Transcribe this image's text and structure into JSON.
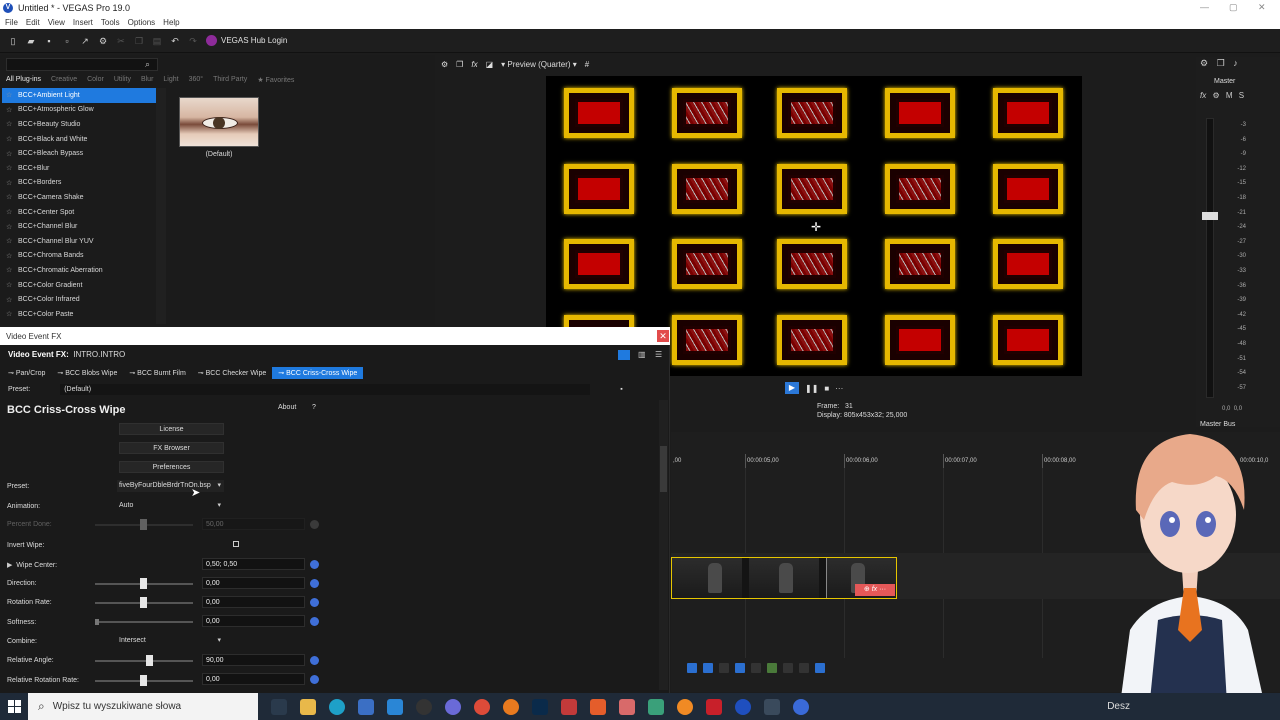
{
  "window": {
    "title": "Untitled * - VEGAS Pro 19.0",
    "logo_letter": "V"
  },
  "menu": [
    "File",
    "Edit",
    "View",
    "Insert",
    "Tools",
    "Options",
    "Help"
  ],
  "toolbar": {
    "hub_label": "VEGAS Hub Login"
  },
  "plugins": {
    "tabs": [
      "All Plug-ins",
      "Creative",
      "Color",
      "Utility",
      "Blur",
      "Light",
      "360°",
      "Third Party",
      "Favorites"
    ],
    "items": [
      "BCC+Ambient Light",
      "BCC+Atmospheric Glow",
      "BCC+Beauty Studio",
      "BCC+Black and White",
      "BCC+Bleach Bypass",
      "BCC+Blur",
      "BCC+Borders",
      "BCC+Camera Shake",
      "BCC+Center Spot",
      "BCC+Channel Blur",
      "BCC+Channel Blur YUV",
      "BCC+Chroma Bands",
      "BCC+Chromatic Aberration",
      "BCC+Color Gradient",
      "BCC+Color Infrared",
      "BCC+Color Paste"
    ],
    "selected_index": 0,
    "preset_thumb_label": "(Default)"
  },
  "preview": {
    "quality": "Preview (Quarter)",
    "frame_label": "Frame:",
    "frame": "31",
    "display_label": "Display:",
    "display": "805x453x32; 25,000"
  },
  "mixer": {
    "title": "Master",
    "bus": "Master Bus",
    "fx": "fx",
    "m": "M",
    "s": "S",
    "scale": [
      "-3",
      "-6",
      "-9",
      "-12",
      "-15",
      "-18",
      "-21",
      "-24",
      "-27",
      "-30",
      "-33",
      "-36",
      "-39",
      "-42",
      "-45",
      "-48",
      "-51",
      "-54",
      "-57"
    ],
    "bottom": [
      "0,0",
      "0,0"
    ]
  },
  "vfx": {
    "window_title": "Video Event FX",
    "header_label": "Video Event FX:",
    "header_value": "INTRO.INTRO",
    "chain": [
      "Pan/Crop",
      "BCC Blobs Wipe",
      "BCC Burnt Film",
      "BCC Checker Wipe",
      "BCC Criss-Cross Wipe"
    ],
    "active_chain_index": 4,
    "preset_label": "Preset:",
    "preset_value": "(Default)",
    "plugin_title": "BCC Criss-Cross Wipe",
    "about": "About",
    "help": "?",
    "buttons": [
      "License",
      "FX Browser",
      "Preferences"
    ],
    "params": {
      "preset_label": "Preset:",
      "preset_value": "fiveByFourDbleBrdrTnOn.bsp",
      "animation_label": "Animation:",
      "animation_value": "Auto",
      "percent_done_label": "Percent Done:",
      "percent_done_value": "50,00",
      "invert_wipe_label": "Invert Wipe:",
      "wipe_center_label": "Wipe Center:",
      "wipe_center_value": "0,50; 0,50",
      "direction_label": "Direction:",
      "direction_value": "0,00",
      "rotation_rate_label": "Rotation Rate:",
      "rotation_rate_value": "0,00",
      "softness_label": "Softness:",
      "softness_value": "0,00",
      "combine_label": "Combine:",
      "combine_value": "Intersect",
      "relative_angle_label": "Relative Angle:",
      "relative_angle_value": "90,00",
      "relative_rotation_rate_label": "Relative Rotation Rate:",
      "relative_rotation_rate_value": "0,00"
    }
  },
  "timeline": {
    "ruler": [
      "00:00:05,00",
      "00:00:06,00",
      "00:00:07,00",
      "00:00:08,00"
    ],
    "ruler_start": ",00",
    "ruler_end": "00:00:10,0",
    "clip_fx": "fx"
  },
  "taskbar": {
    "search_placeholder": "Wpisz tu wyszukiwane słowa",
    "tray": "Desz"
  },
  "colors": {
    "accent": "#1f7adf",
    "clip_border": "#e6c600",
    "tile_border": "#e6b800",
    "tile_fill": "#c40000"
  }
}
